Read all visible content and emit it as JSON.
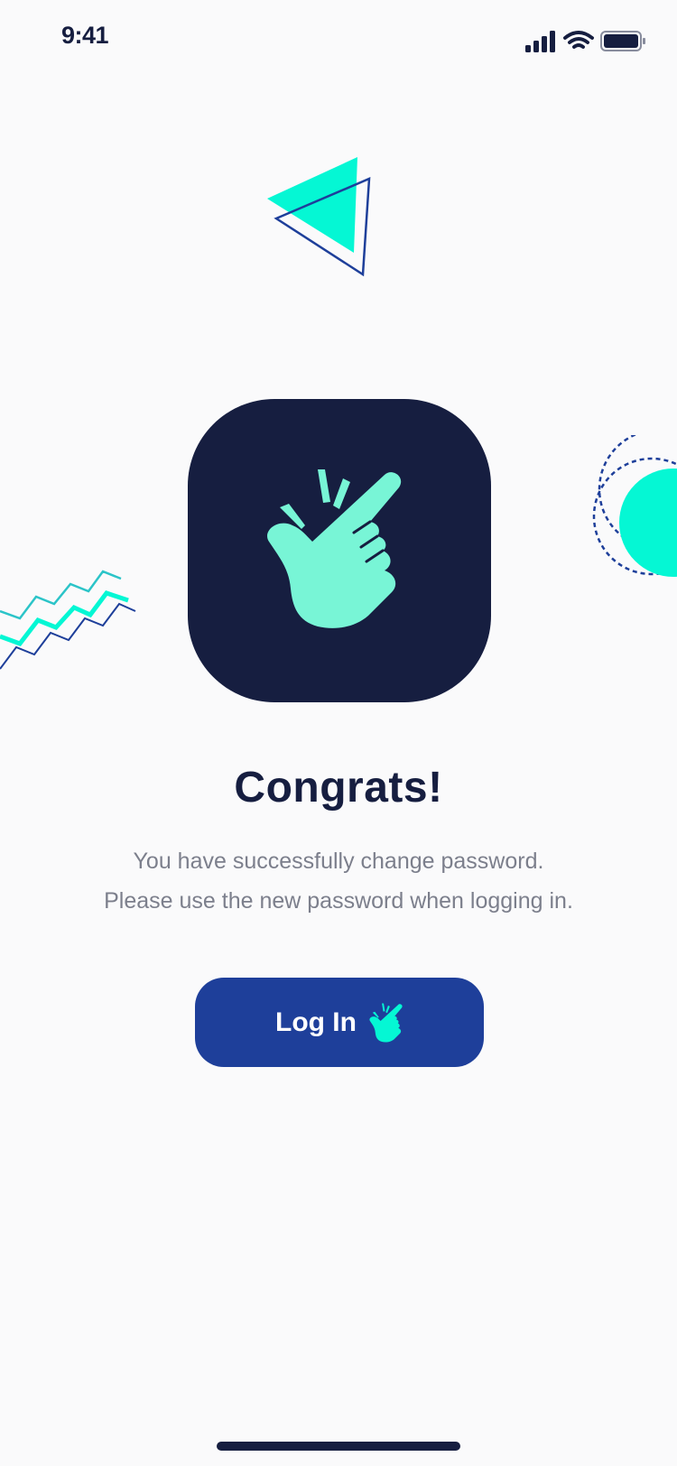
{
  "status_bar": {
    "time": "9:41",
    "signal_icon": "cellular-signal-icon",
    "wifi_icon": "wifi-icon",
    "battery_icon": "battery-icon"
  },
  "hero": {
    "icon": "finger-snap-icon"
  },
  "content": {
    "title": "Congrats!",
    "message_line1": "You have successfully change password.",
    "message_line2": "Please use the new password when logging in."
  },
  "login_button": {
    "label": "Log In",
    "icon": "finger-snap-icon"
  },
  "colors": {
    "background": "#FAFAFB",
    "navy": "#161E40",
    "primary_blue": "#1E3F9A",
    "accent_mint": "#05F7D4",
    "hand_mint": "#78F5D6",
    "muted_text": "#7C7F8C"
  }
}
